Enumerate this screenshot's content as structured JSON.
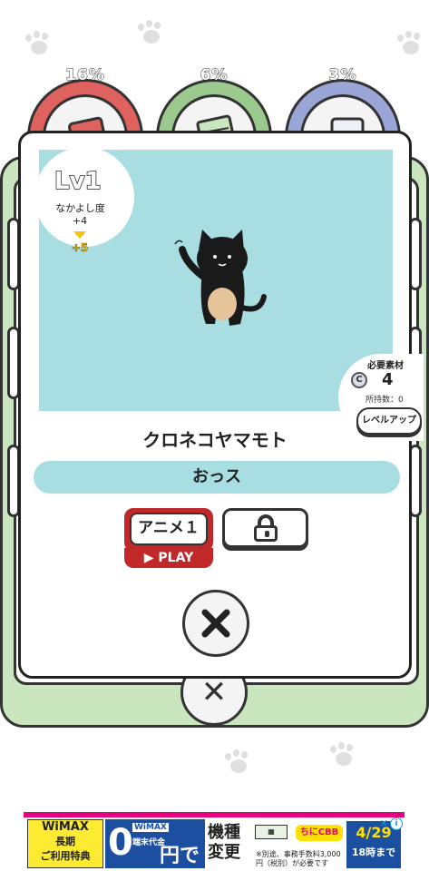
{
  "gauges": [
    {
      "percent": "16%",
      "color": "#e0625f",
      "fill_fraction": 0.16,
      "icon": "card-icon"
    },
    {
      "percent": "6%",
      "color": "#9cc98e",
      "fill_fraction": 0.06,
      "icon": "notebook-icon"
    },
    {
      "percent": "3%",
      "color": "#9aa6d6",
      "fill_fraction": 0.03,
      "icon": "speaker-icon"
    }
  ],
  "character": {
    "level": "Lv1",
    "affinity_label": "なかよし度",
    "affinity_current": "+4",
    "affinity_next": "+5",
    "name": "クロネコヤマモト",
    "line": "おっス",
    "art_bg": "#a8dde2"
  },
  "material": {
    "label": "必要素材",
    "coin_symbol": "C",
    "required": "4",
    "owned": "所持数：0",
    "levelup_label": "レベルアップ"
  },
  "actions": {
    "anim_label": "アニメ１",
    "play_label": "▶ PLAY",
    "close_symbol": "✕"
  },
  "ad": {
    "wimax": "WiMAX",
    "long": "長期",
    "benefit": "ご利用特典",
    "zero": "0",
    "wimax_small": "WiMAX",
    "terminal_cost": "端末代金",
    "yen": "円で",
    "kishu": "機種",
    "henko": "変更",
    "brand": "ちにCBB",
    "note": "※別途、事務手数料3,000円（税別）が必要です",
    "date": "4/29",
    "until": "18時まで",
    "info": "i",
    "close": "✕"
  }
}
